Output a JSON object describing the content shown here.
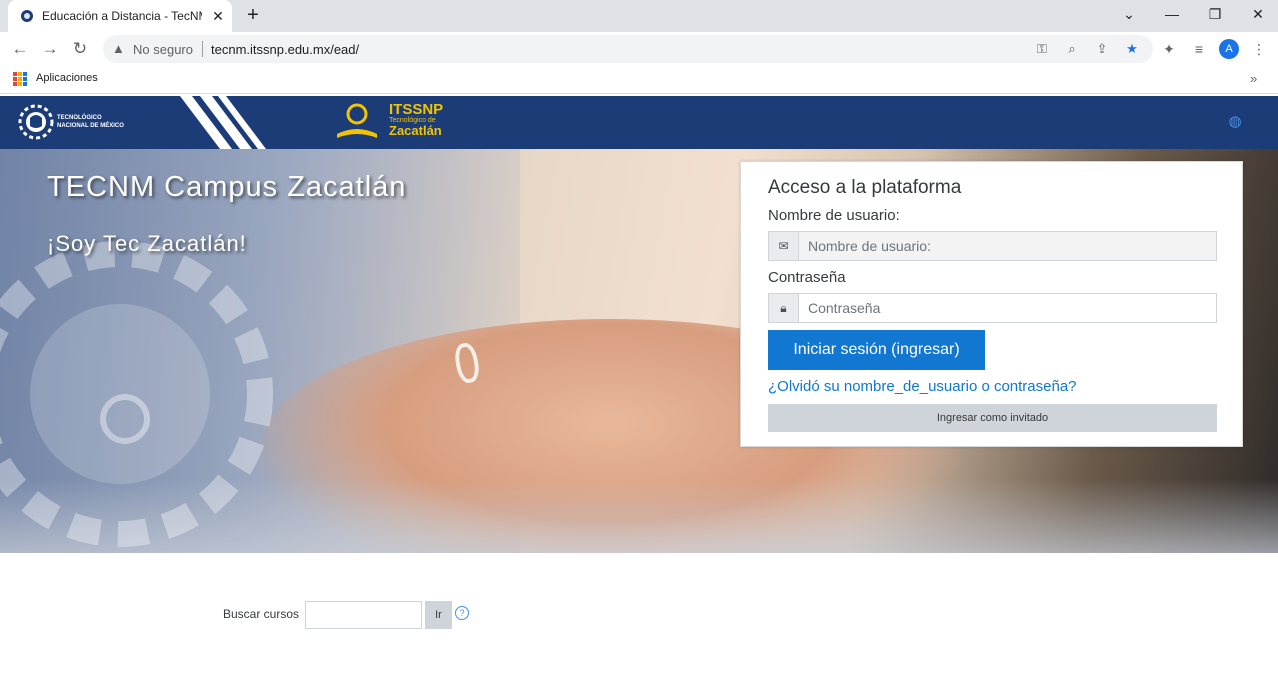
{
  "browser": {
    "tab_title": "Educación a Distancia - TecNM C",
    "tab_close": "✕",
    "new_tab": "+",
    "security_label": "No seguro",
    "url": "tecnm.itssnp.edu.mx/ead/",
    "bookmarks_apps_label": "Aplicaciones",
    "bookmarks_more": "»",
    "profile_initial": "A",
    "icons": [
      "back-icon",
      "forward-icon",
      "reload-icon",
      "warning-icon",
      "key-icon",
      "zoom-icon",
      "share-icon",
      "bookmark-star-icon",
      "extensions-icon",
      "media-icon",
      "menu-icon"
    ]
  },
  "header": {
    "tecnm_text": "TECNOLÓGICO NACIONAL DE MÉXICO",
    "itssnp_title": "ITSSNP",
    "itssnp_subtitle": "Tecnológico de",
    "itssnp_city": "Zacatlán",
    "colors": {
      "bar": "#1c3c78",
      "accent": "#f2c300"
    }
  },
  "hero": {
    "title": "TECNM Campus Zacatlán",
    "subtitle": "¡Soy Tec Zacatlán!"
  },
  "login": {
    "title": "Acceso a la plataforma",
    "username_label": "Nombre de usuario:",
    "username_placeholder": "Nombre de usuario:",
    "password_label": "Contraseña",
    "password_placeholder": "Contraseña",
    "submit_label": "Iniciar sesión (ingresar)",
    "forgot_link": "¿Olvidó su nombre_de_usuario o contraseña?",
    "guest_label": "Ingresar como invitado",
    "colors": {
      "primary": "#1177d1"
    }
  },
  "course_search": {
    "label": "Buscar cursos",
    "button": "Ir",
    "help": "?"
  }
}
